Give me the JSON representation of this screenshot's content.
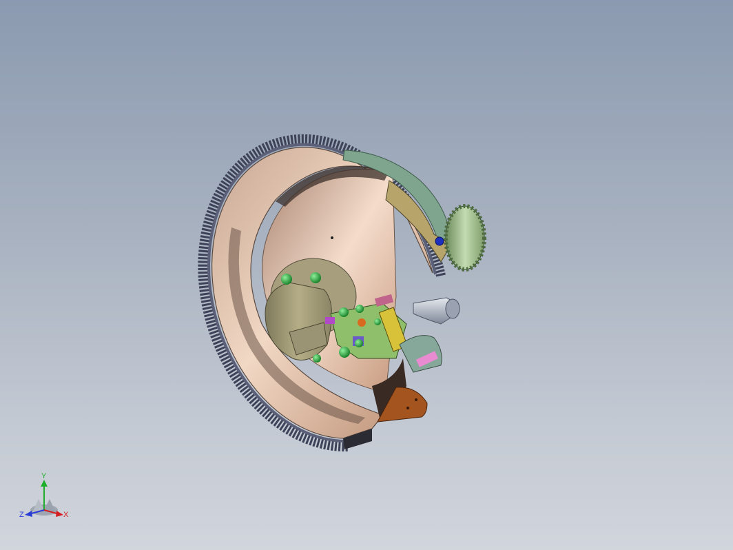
{
  "viewport": {
    "background_top": "#8b9ab0",
    "background_bottom": "#d1d5dc"
  },
  "model": {
    "name": "flywheel-clutch-assembly-section",
    "colors": {
      "ring_gear": "#4b5068",
      "flywheel_face": "#d9b9a2",
      "flywheel_inner": "#c8a48e",
      "hub": "#9c9674",
      "bolts": "#2aa33c",
      "pinion": "#9fc48e",
      "housing": "#7fa58f",
      "shaft": "#b7bfcf",
      "sector": "#a0511f"
    }
  },
  "triad": {
    "x_label": "X",
    "y_label": "Y",
    "z_label": "Z",
    "x_color": "#d42020",
    "y_color": "#1fae2b",
    "z_color": "#2a3cd6"
  }
}
